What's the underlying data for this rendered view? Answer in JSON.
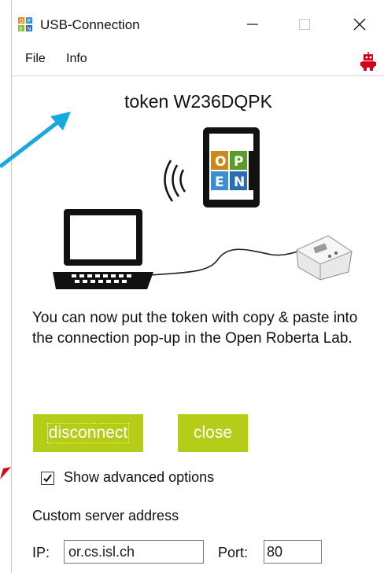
{
  "window": {
    "title": "USB-Connection",
    "controls": [
      "minimize-icon",
      "maximize-icon",
      "close-icon"
    ]
  },
  "menu": {
    "items": [
      {
        "label": "File"
      },
      {
        "label": "Info"
      }
    ],
    "right_icon": "robot-icon"
  },
  "token": {
    "text": "token W236DQPK"
  },
  "illustration": {
    "phone_letters": [
      "O",
      "P",
      "E",
      "N"
    ],
    "icons": [
      "laptop-icon",
      "wifi-signal-icon",
      "phone-icon",
      "robot-brick-icon"
    ]
  },
  "message": {
    "text": "You can now put the token with copy & paste into the connection pop-up in the Open Roberta Lab."
  },
  "buttons": {
    "disconnect": "disconnect",
    "close": "close"
  },
  "advanced": {
    "checkbox_label": "Show advanced options",
    "checked": true
  },
  "server": {
    "label": "Custom server address",
    "ip_label": "IP:",
    "ip_value": "or.cs.isl.ch",
    "port_label": "Port:",
    "port_value": "80"
  },
  "colors": {
    "button_bg": "#b5cc18",
    "arrow_blue": "#17a8e0",
    "arrow_red": "#e0001b"
  }
}
